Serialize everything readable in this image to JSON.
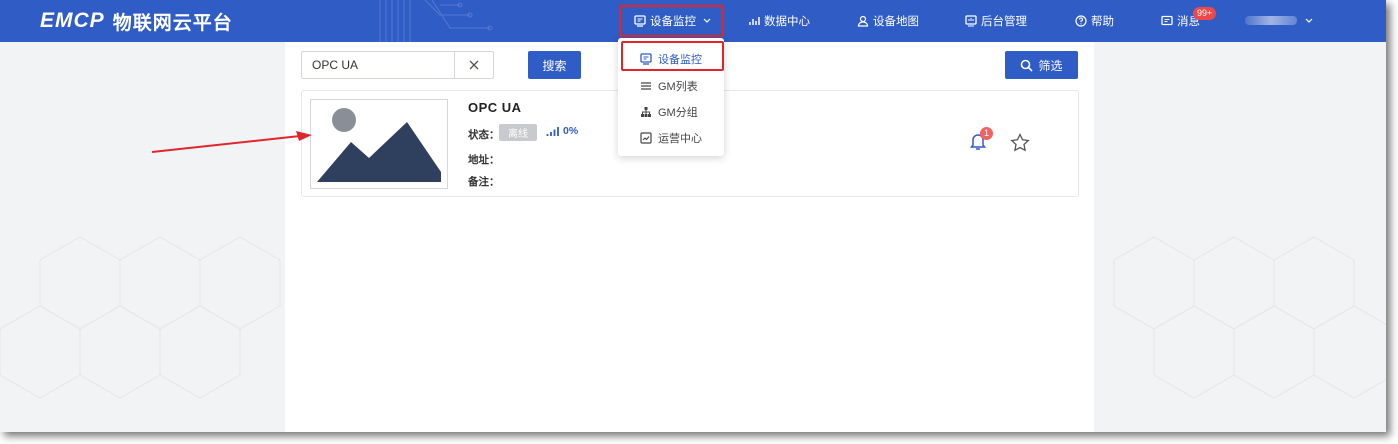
{
  "app": {
    "brand": "EMCP",
    "brand_subtitle": "物联网云平台"
  },
  "nav": {
    "items": [
      {
        "label": "设备监控",
        "icon": "monitor-icon",
        "active": true
      },
      {
        "label": "数据中心",
        "icon": "chart-icon"
      },
      {
        "label": "设备地图",
        "icon": "user-pin-icon"
      },
      {
        "label": "后台管理",
        "icon": "admin-icon"
      },
      {
        "label": "帮助",
        "icon": "help-icon"
      },
      {
        "label": "消息",
        "icon": "message-icon",
        "badge": "99+"
      }
    ]
  },
  "dropdown": {
    "items": [
      {
        "label": "设备监控",
        "icon": "monitor-icon",
        "active": true
      },
      {
        "label": "GM列表",
        "icon": "list-icon"
      },
      {
        "label": "GM分组",
        "icon": "group-icon"
      },
      {
        "label": "运营中心",
        "icon": "operation-chart-icon"
      }
    ]
  },
  "search": {
    "value": "OPC UA",
    "search_label": "搜索",
    "filter_label": "筛选"
  },
  "device": {
    "name": "OPC UA",
    "status_label": "状态：",
    "status_value": "离线",
    "signal": "0%",
    "address_label": "地址：",
    "address_value": "",
    "note_label": "备注：",
    "note_value": "",
    "alarm_count": "1"
  },
  "colors": {
    "primary": "#2f5cc5",
    "highlight": "#e0262b",
    "offline": "#c8cacd",
    "badge": "#f04848"
  }
}
